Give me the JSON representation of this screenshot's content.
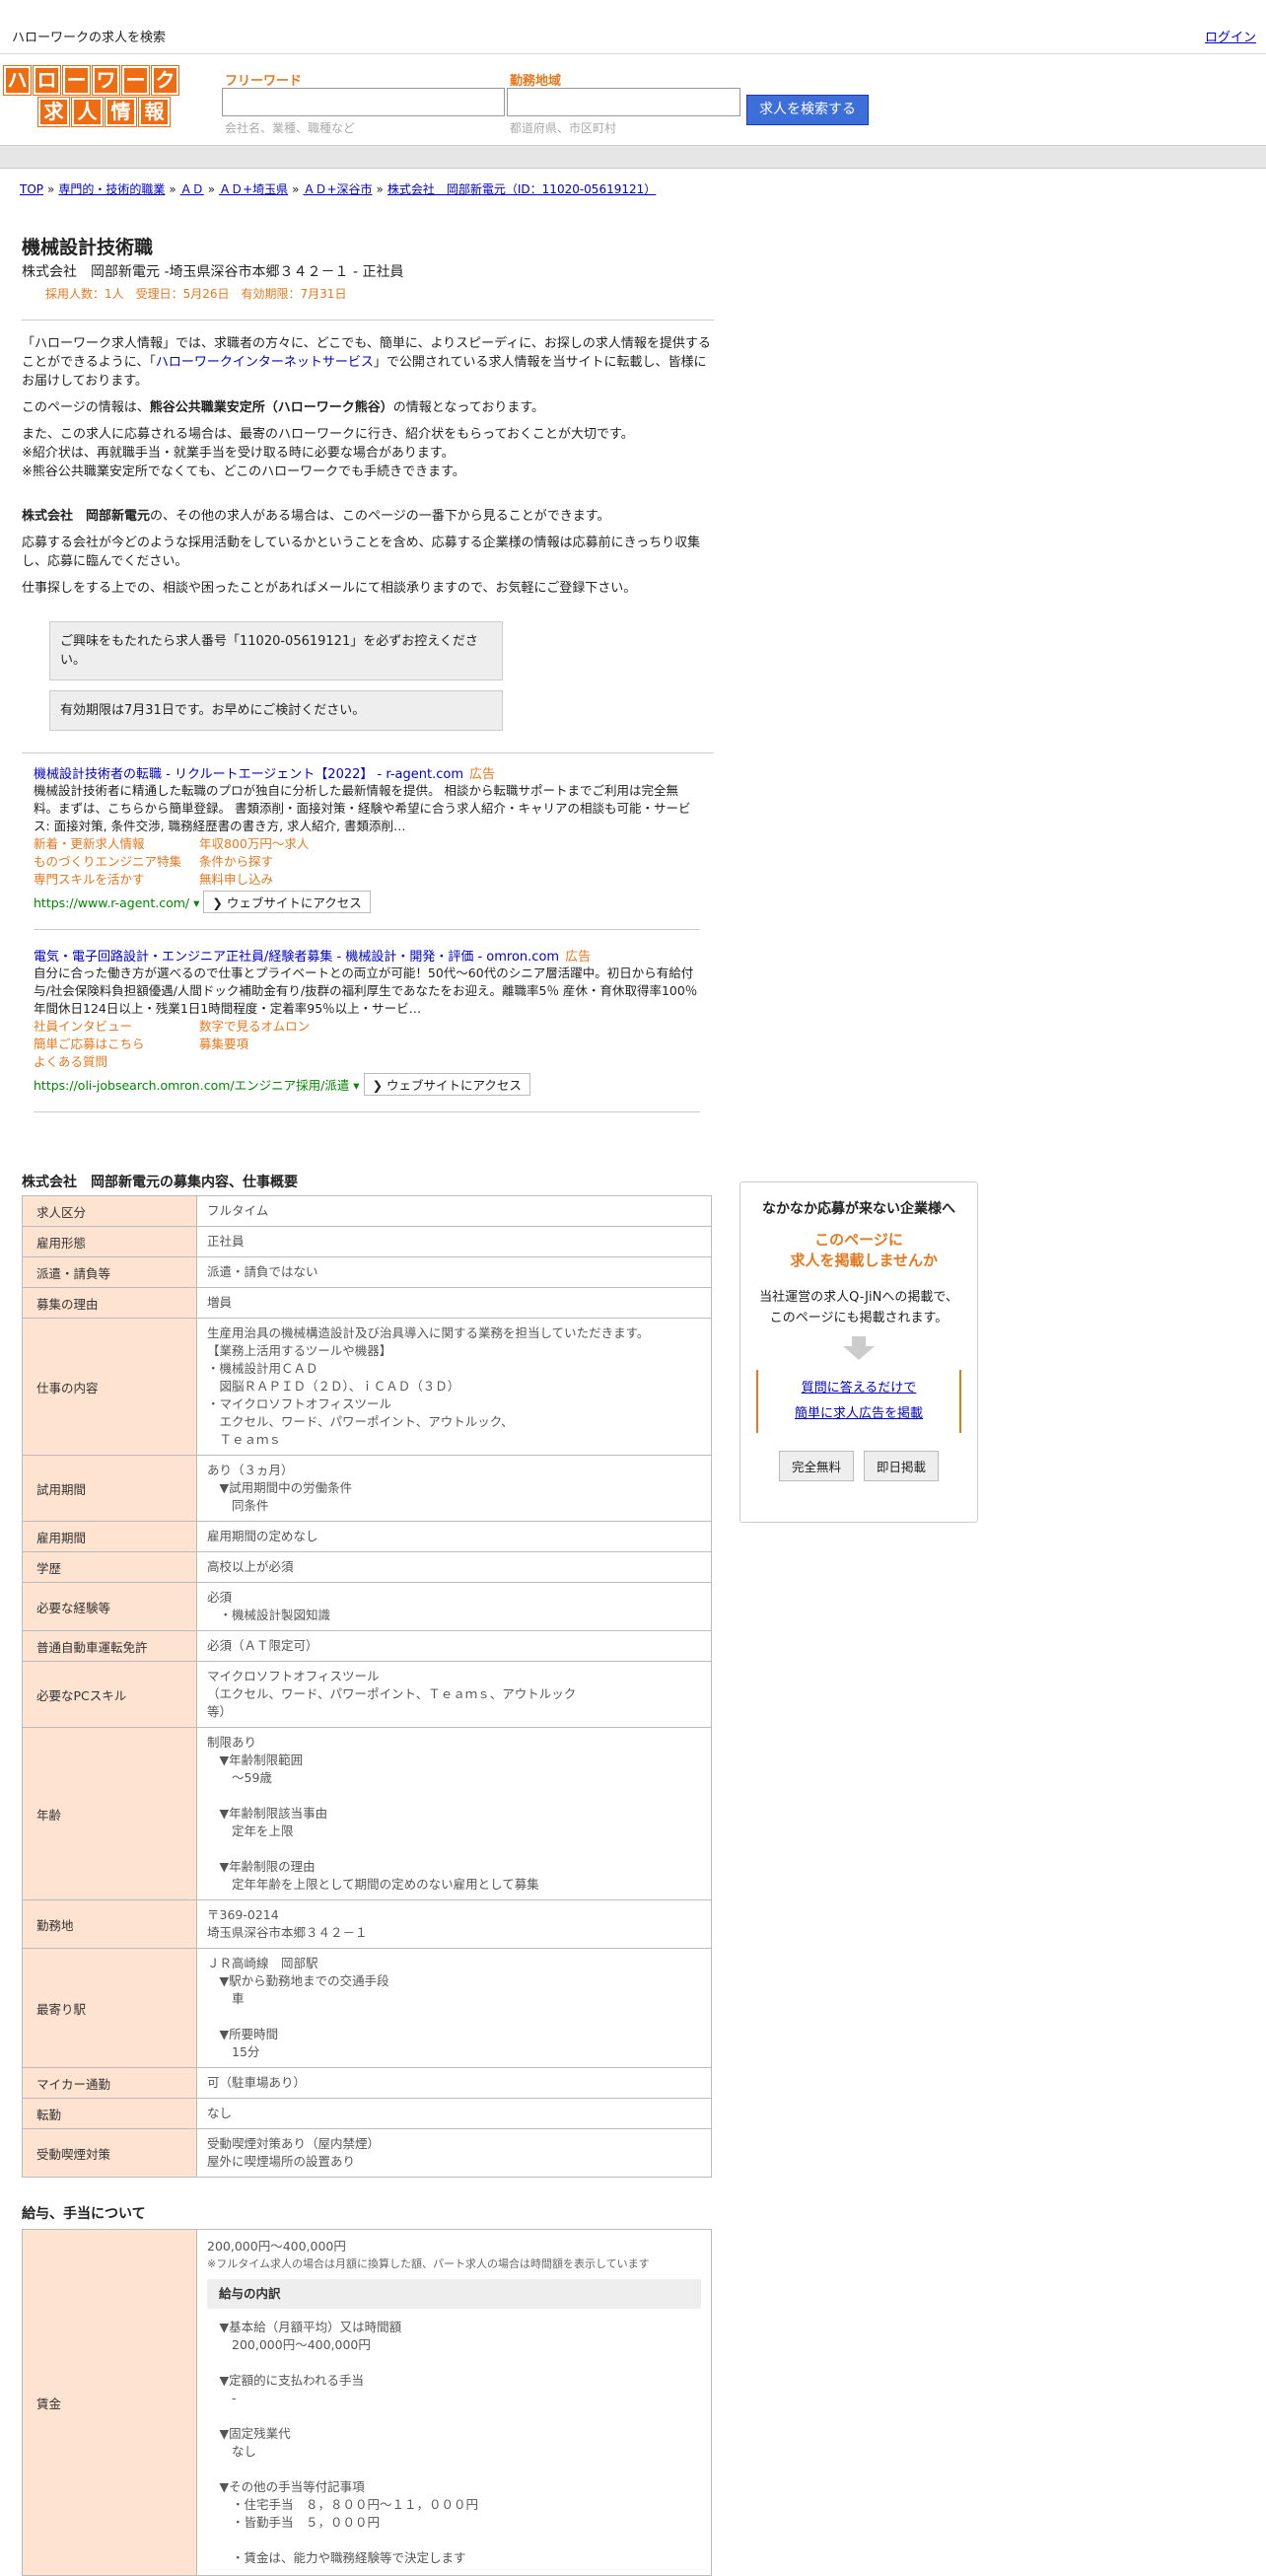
{
  "topbar": {
    "title": "ハローワークの求人を検索",
    "login": "ログイン"
  },
  "logo": {
    "row1": [
      "ハ",
      "ロ",
      "ー",
      "ワ",
      "ー",
      "ク"
    ],
    "row2": [
      "求",
      "人",
      "情",
      "報"
    ]
  },
  "search": {
    "freeword_label": "フリーワード",
    "freeword_placeholder": "会社名、業種、職種など",
    "area_label": "勤務地域",
    "area_placeholder": "都道府県、市区町村",
    "button": "求人を検索する"
  },
  "breadcrumb": [
    "TOP",
    "専門的・技術的職業",
    "ＡＤ",
    "ＡＤ+埼玉県",
    "ＡＤ+深谷市",
    "株式会社　岡部新電元（ID：11020-05619121）"
  ],
  "breadcrumb_sep": "»",
  "job": {
    "title": "機械設計技術職",
    "subtitle": "株式会社　岡部新電元 -埼玉県深谷市本郷３４２－１ - 正社員",
    "meta": "採用人数：1人　受理日：5月26日　有効期限：7月31日"
  },
  "intro": {
    "p1a": "「ハローワーク求人情報」では、求職者の方々に、どこでも、簡単に、よりスピーディに、お探しの求人情報を提供することができるように、「",
    "p1link": "ハローワークインターネットサービス",
    "p1b": "」で公開されている求人情報を当サイトに転載し、皆様にお届けしております。",
    "p2a": "このページの情報は、",
    "p2bold": "熊谷公共職業安定所（ハローワーク熊谷）",
    "p2b": "の情報となっております。",
    "p3": "また、この求人に応募される場合は、最寄のハローワークに行き、紹介状をもらっておくことが大切です。",
    "p3b": "※紹介状は、再就職手当・就業手当を受け取る時に必要な場合があります。",
    "p3c": "※熊谷公共職業安定所でなくても、どこのハローワークでも手続きできます。",
    "p4bold": "株式会社　岡部新電元",
    "p4": "の、その他の求人がある場合は、このページの一番下から見ることができます。",
    "p5": "応募する会社が今どのような採用活動をしているかということを含め、応募する企業様の情報は応募前にきっちり収集し、応募に臨んでください。",
    "p6": "仕事探しをする上での、相談や困ったことがあればメールにて相談承りますので、お気軽にご登録下さい。"
  },
  "notes": [
    "ご興味をもたれたら求人番号「11020-05619121」を必ずお控えください。",
    "有効期限は7月31日です。お早めにご検討ください。"
  ],
  "ads": [
    {
      "title": "機械設計技術者の転職 - リクルートエージェント【2022】 - r-agent.com",
      "label": "広告",
      "desc": "機械設計技術者に精通した転職のプロが独自に分析した最新情報を提供。 相談から転職サポートまでご利用は完全無料。まずは、こちらから簡単登録。 書類添削・面接対策・経験や希望に合う求人紹介・キャリアの相談も可能・サービス: 面接対策, 条件交渉, 職務経歴書の書き方, 求人紹介, 書類添削…",
      "links": [
        "新着・更新求人情報",
        "年収800万円～求人",
        "ものづくりエンジニア特集",
        "条件から探す",
        "専門スキルを活かす",
        "無料申し込み"
      ],
      "url": "https://www.r-agent.com/",
      "btn": "❯ ウェブサイトにアクセス"
    },
    {
      "title": "電気・電子回路設計・エンジニア正社員/経験者募集 - 機械設計・開発・評価 - omron.com",
      "label": "広告",
      "desc": "自分に合った働き方が選べるので仕事とプライベートとの両立が可能！50代～60代のシニア層活躍中。初日から有給付与/社会保険料負担額優遇/人間ドック補助金有り/抜群の福利厚生であなたをお迎え。離職率5％ 産休・育休取得率100％ 年間休日124日以上・残業1日1時間程度・定着率95％以上・サービ…",
      "links": [
        "社員インタビュー",
        "数字で見るオムロン",
        "簡単ご応募はこちら",
        "募集要項",
        "よくある質問",
        ""
      ],
      "url": "https://oli-jobsearch.omron.com/エンジニア採用/派遣",
      "btn": "❯ ウェブサイトにアクセス"
    }
  ],
  "table_title": "株式会社　岡部新電元の募集内容、仕事概要",
  "rows": [
    {
      "k": "求人区分",
      "v": "フルタイム"
    },
    {
      "k": "雇用形態",
      "v": "正社員"
    },
    {
      "k": "派遣・請負等",
      "v": "派遣・請負ではない"
    },
    {
      "k": "募集の理由",
      "v": "増員"
    },
    {
      "k": "仕事の内容",
      "v": "生産用治具の機械構造設計及び治具導入に関する業務を担当していただきます。\n【業務上活用するツールや機器】\n・機械設計用ＣＡＤ\n　図脳ＲＡＰＩＤ（２Ｄ）、ｉＣＡＤ（３Ｄ）\n・マイクロソフトオフィスツール\n　エクセル、ワード、パワーポイント、アウトルック、\n　Ｔｅａｍｓ"
    },
    {
      "k": "試用期間",
      "v": "あり（３ヵ月）\n　▼試用期間中の労働条件\n　　同条件"
    },
    {
      "k": "雇用期間",
      "v": "雇用期間の定めなし"
    },
    {
      "k": "学歴",
      "v": "高校以上が必須"
    },
    {
      "k": "必要な経験等",
      "v": "必須\n　・機械設計製図知識"
    },
    {
      "k": "普通自動車運転免許",
      "v": "必須（ＡＴ限定可）"
    },
    {
      "k": "必要なPCスキル",
      "v": "マイクロソフトオフィスツール\n（エクセル、ワード、パワーポイント、Ｔｅａｍｓ、アウトルック\n等）"
    },
    {
      "k": "年齢",
      "v": "制限あり\n　▼年齢制限範囲\n　　〜59歳\n\n　▼年齢制限該当事由\n　　定年を上限\n\n　▼年齢制限の理由\n　　定年年齢を上限として期間の定めのない雇用として募集"
    },
    {
      "k": "勤務地",
      "v": "〒369-0214\n埼玉県深谷市本郷３４２－１"
    },
    {
      "k": "最寄り駅",
      "v": "ＪＲ高崎線　岡部駅\n　▼駅から勤務地までの交通手段\n　　車\n\n　▼所要時間\n　　15分"
    },
    {
      "k": "マイカー通勤",
      "v": "可（駐車場あり）"
    },
    {
      "k": "転勤",
      "v": "なし"
    },
    {
      "k": "受動喫煙対策",
      "v": "受動喫煙対策あり（屋内禁煙）\n屋外に喫煙場所の設置あり"
    }
  ],
  "salary": {
    "title": "給与、手当について",
    "key": "賃金",
    "range": "200,000円〜400,000円",
    "note": "※フルタイム求人の場合は月額に換算した額、パート求人の場合は時間額を表示しています",
    "breakdown_label": "給与の内訳",
    "detail": "　▼基本給（月額平均）又は時間額\n　　200,000円〜400,000円\n\n　▼定額的に支払われる手当\n　　-\n\n　▼固定残業代\n　　なし\n\n　▼その他の手当等付記事項\n　　・住宅手当　８，８００円～１１，０００円\n　　・皆勤手当　５，０００円\n\n　　・賃金は、能力や職務経験等で決定します"
  },
  "side": {
    "head": "なかなか応募が来ない企業様へ",
    "cta1": "このページに",
    "cta2": "求人を掲載しませんか",
    "body1": "当社運営の求人Q-JiNへの掲載で、",
    "body2": "このページにも掲載されます。",
    "link1": "質問に答えるだけで",
    "link2": "簡単に求人広告を掲載",
    "pill1": "完全無料",
    "pill2": "即日掲載"
  }
}
